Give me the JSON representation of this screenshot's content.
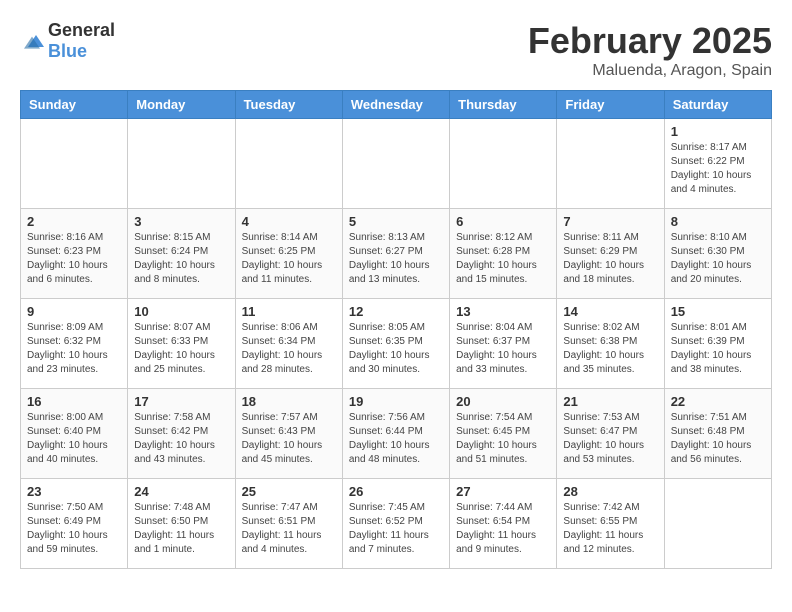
{
  "logo": {
    "general": "General",
    "blue": "Blue"
  },
  "title": "February 2025",
  "subtitle": "Maluenda, Aragon, Spain",
  "days_of_week": [
    "Sunday",
    "Monday",
    "Tuesday",
    "Wednesday",
    "Thursday",
    "Friday",
    "Saturday"
  ],
  "weeks": [
    [
      {
        "day": "",
        "info": ""
      },
      {
        "day": "",
        "info": ""
      },
      {
        "day": "",
        "info": ""
      },
      {
        "day": "",
        "info": ""
      },
      {
        "day": "",
        "info": ""
      },
      {
        "day": "",
        "info": ""
      },
      {
        "day": "1",
        "info": "Sunrise: 8:17 AM\nSunset: 6:22 PM\nDaylight: 10 hours and 4 minutes."
      }
    ],
    [
      {
        "day": "2",
        "info": "Sunrise: 8:16 AM\nSunset: 6:23 PM\nDaylight: 10 hours and 6 minutes."
      },
      {
        "day": "3",
        "info": "Sunrise: 8:15 AM\nSunset: 6:24 PM\nDaylight: 10 hours and 8 minutes."
      },
      {
        "day": "4",
        "info": "Sunrise: 8:14 AM\nSunset: 6:25 PM\nDaylight: 10 hours and 11 minutes."
      },
      {
        "day": "5",
        "info": "Sunrise: 8:13 AM\nSunset: 6:27 PM\nDaylight: 10 hours and 13 minutes."
      },
      {
        "day": "6",
        "info": "Sunrise: 8:12 AM\nSunset: 6:28 PM\nDaylight: 10 hours and 15 minutes."
      },
      {
        "day": "7",
        "info": "Sunrise: 8:11 AM\nSunset: 6:29 PM\nDaylight: 10 hours and 18 minutes."
      },
      {
        "day": "8",
        "info": "Sunrise: 8:10 AM\nSunset: 6:30 PM\nDaylight: 10 hours and 20 minutes."
      }
    ],
    [
      {
        "day": "9",
        "info": "Sunrise: 8:09 AM\nSunset: 6:32 PM\nDaylight: 10 hours and 23 minutes."
      },
      {
        "day": "10",
        "info": "Sunrise: 8:07 AM\nSunset: 6:33 PM\nDaylight: 10 hours and 25 minutes."
      },
      {
        "day": "11",
        "info": "Sunrise: 8:06 AM\nSunset: 6:34 PM\nDaylight: 10 hours and 28 minutes."
      },
      {
        "day": "12",
        "info": "Sunrise: 8:05 AM\nSunset: 6:35 PM\nDaylight: 10 hours and 30 minutes."
      },
      {
        "day": "13",
        "info": "Sunrise: 8:04 AM\nSunset: 6:37 PM\nDaylight: 10 hours and 33 minutes."
      },
      {
        "day": "14",
        "info": "Sunrise: 8:02 AM\nSunset: 6:38 PM\nDaylight: 10 hours and 35 minutes."
      },
      {
        "day": "15",
        "info": "Sunrise: 8:01 AM\nSunset: 6:39 PM\nDaylight: 10 hours and 38 minutes."
      }
    ],
    [
      {
        "day": "16",
        "info": "Sunrise: 8:00 AM\nSunset: 6:40 PM\nDaylight: 10 hours and 40 minutes."
      },
      {
        "day": "17",
        "info": "Sunrise: 7:58 AM\nSunset: 6:42 PM\nDaylight: 10 hours and 43 minutes."
      },
      {
        "day": "18",
        "info": "Sunrise: 7:57 AM\nSunset: 6:43 PM\nDaylight: 10 hours and 45 minutes."
      },
      {
        "day": "19",
        "info": "Sunrise: 7:56 AM\nSunset: 6:44 PM\nDaylight: 10 hours and 48 minutes."
      },
      {
        "day": "20",
        "info": "Sunrise: 7:54 AM\nSunset: 6:45 PM\nDaylight: 10 hours and 51 minutes."
      },
      {
        "day": "21",
        "info": "Sunrise: 7:53 AM\nSunset: 6:47 PM\nDaylight: 10 hours and 53 minutes."
      },
      {
        "day": "22",
        "info": "Sunrise: 7:51 AM\nSunset: 6:48 PM\nDaylight: 10 hours and 56 minutes."
      }
    ],
    [
      {
        "day": "23",
        "info": "Sunrise: 7:50 AM\nSunset: 6:49 PM\nDaylight: 10 hours and 59 minutes."
      },
      {
        "day": "24",
        "info": "Sunrise: 7:48 AM\nSunset: 6:50 PM\nDaylight: 11 hours and 1 minute."
      },
      {
        "day": "25",
        "info": "Sunrise: 7:47 AM\nSunset: 6:51 PM\nDaylight: 11 hours and 4 minutes."
      },
      {
        "day": "26",
        "info": "Sunrise: 7:45 AM\nSunset: 6:52 PM\nDaylight: 11 hours and 7 minutes."
      },
      {
        "day": "27",
        "info": "Sunrise: 7:44 AM\nSunset: 6:54 PM\nDaylight: 11 hours and 9 minutes."
      },
      {
        "day": "28",
        "info": "Sunrise: 7:42 AM\nSunset: 6:55 PM\nDaylight: 11 hours and 12 minutes."
      },
      {
        "day": "",
        "info": ""
      }
    ]
  ]
}
